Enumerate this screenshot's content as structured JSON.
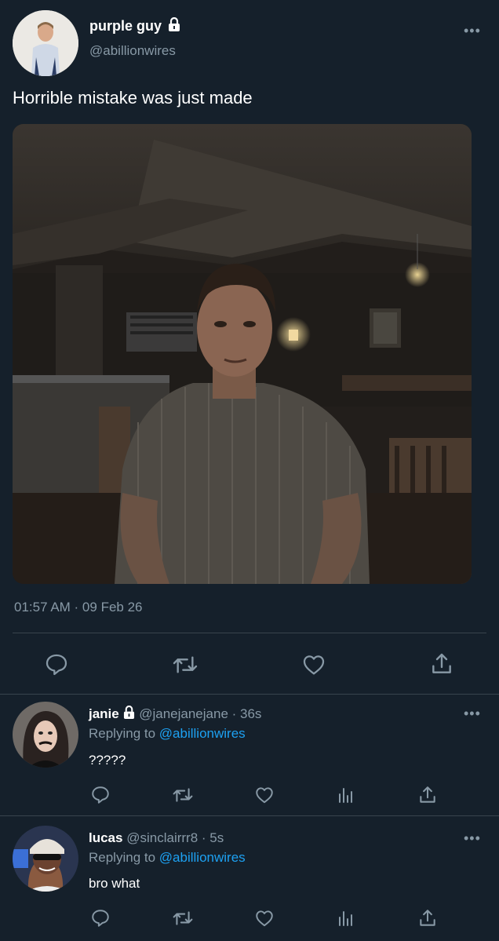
{
  "main_tweet": {
    "display_name": "purple guy",
    "handle": "@abillionwires",
    "text": "Horrible mistake was just made",
    "timestamp": "01:57 AM · 09 Feb 26",
    "icons": [
      "comment-icon",
      "retweet-icon",
      "like-icon",
      "share-icon"
    ]
  },
  "replies": [
    {
      "display_name": "janie",
      "handle": "@janejanejane",
      "time": "· 36s",
      "replying_label": "Replying to",
      "replying_to": "@abillionwires",
      "text": "?????"
    },
    {
      "display_name": "lucas",
      "handle": "@sinclairrr8",
      "time": "· 5s",
      "replying_label": "Replying to",
      "replying_to": "@abillionwires",
      "text": "bro what"
    }
  ],
  "colors": {
    "background": "#15202b",
    "muted": "#8899a6",
    "link": "#1da1f2",
    "divider": "#38444d"
  }
}
